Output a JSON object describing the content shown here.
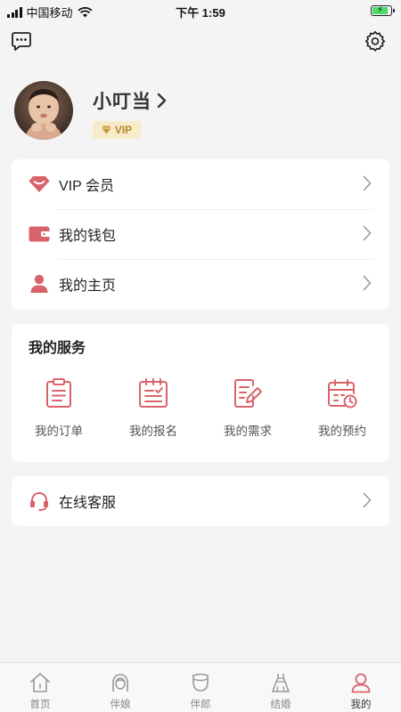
{
  "status_bar": {
    "carrier": "中国移动",
    "time": "下午 1:59"
  },
  "profile": {
    "username": "小叮当",
    "badge": "VIP"
  },
  "menu": {
    "items": [
      {
        "label": "VIP 会员",
        "icon": "vip-icon"
      },
      {
        "label": "我的钱包",
        "icon": "wallet-icon"
      },
      {
        "label": "我的主页",
        "icon": "user-icon"
      }
    ]
  },
  "services": {
    "title": "我的服务",
    "items": [
      {
        "label": "我的订单",
        "icon": "clipboard-icon"
      },
      {
        "label": "我的报名",
        "icon": "checklist-icon"
      },
      {
        "label": "我的需求",
        "icon": "edit-document-icon"
      },
      {
        "label": "我的预约",
        "icon": "calendar-icon"
      }
    ]
  },
  "support": {
    "label": "在线客服",
    "icon": "headset-icon"
  },
  "tab_bar": {
    "items": [
      {
        "label": "首页",
        "icon": "home-icon"
      },
      {
        "label": "伴娘",
        "icon": "bridesmaid-icon"
      },
      {
        "label": "伴郎",
        "icon": "groomsman-icon"
      },
      {
        "label": "结婚",
        "icon": "wedding-dress-icon"
      },
      {
        "label": "我的",
        "icon": "profile-icon"
      }
    ],
    "active": "我的"
  },
  "colors": {
    "accent": "#d9636a",
    "vip_text": "#b58a31",
    "vip_bg": "#f7ebc9",
    "background": "#f4f4f4"
  }
}
